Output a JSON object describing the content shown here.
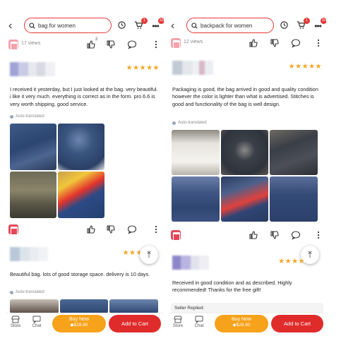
{
  "left": {
    "search_query": "bag for women",
    "badges": {
      "cart": "1",
      "more": "10"
    },
    "views": "17 views",
    "like_count": "2",
    "review1": {
      "text": "I received it yesterday, but I just looked at the bag. very beautiful. i like it very much. everything is correct as in the form. pro 6.6 is very worth shipping, good service.",
      "auto_translated": "Auto-translated",
      "stars": "★★★★★"
    },
    "review2": {
      "text": "Beautiful bag. lots of good storage space. delivery is 10 days.",
      "auto_translated": "Auto-translated",
      "stars": "★★★"
    },
    "bottom": {
      "store": "Store",
      "chat": "Chat",
      "buy_now": "Buy Now",
      "buy_price": "◆$28.80",
      "add_to_cart": "Add to Cart"
    }
  },
  "right": {
    "search_query": "backpack for women",
    "badges": {
      "cart": "1",
      "more": "10"
    },
    "views": "12 views",
    "review1": {
      "text": "Packaging is good,  the bag arrived in good and quality condition however the color is lighter than what is advertised.  Stitches is good and functionality of the bag is well design.",
      "auto_translated": "Auto-translated",
      "stars": "★★★★★"
    },
    "review2": {
      "text": "Received in good condition and as described. Highly recommended! Thanks for the free gift!",
      "stars": "★★★★",
      "seller_replied": "Seller Replied:"
    },
    "bottom": {
      "store": "Store",
      "chat": "Chat",
      "buy_now": "Buy Now",
      "buy_price": "◆$28.80",
      "add_to_cart": "Add to Cart"
    }
  },
  "icons": {
    "back": "back-arrow-icon",
    "search": "search-icon",
    "history": "history-icon",
    "cart": "cart-icon",
    "more": "more-icon",
    "like": "thumbs-up-icon",
    "dislike": "thumbs-down-icon",
    "comment": "comment-icon",
    "kebab": "kebab-menu-icon",
    "scroll_top": "scroll-top-icon"
  },
  "colors": {
    "accent": "#e53935",
    "star": "#f5a623",
    "buy": "#f7a21b",
    "cart": "#e02b2b"
  }
}
